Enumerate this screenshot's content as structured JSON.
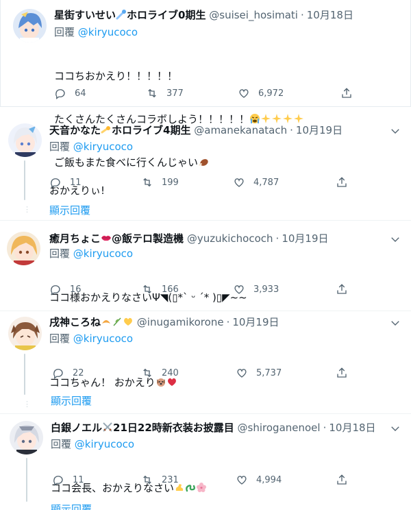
{
  "reply_prefix": "回覆",
  "show_replies_label": "顯示回覆",
  "tweets": [
    {
      "name": "星街すいせい",
      "name_suffix": "ホロライブ0期生",
      "handle": "@suisei_hosimati",
      "separator": "·",
      "time": "10月18日",
      "reply_to": "@kiryucoco",
      "lines": [
        "ココちおかえり！！！！！",
        "たくさんたくさんコラボしよう！！！！！",
        "ご飯もまた食べに行くんじゃい"
      ],
      "replies": "64",
      "retweets": "377",
      "likes": "6,972"
    },
    {
      "name": "天音かなた",
      "name_suffix": "ホロライブ4期生",
      "handle": "@amanekanatach",
      "separator": "·",
      "time": "10月19日",
      "reply_to": "@kiryucoco",
      "lines": [
        "おかえりぃ!"
      ],
      "replies": "11",
      "retweets": "199",
      "likes": "4,787"
    },
    {
      "name": "癒月ちょこ",
      "name_suffix": "@飯テロ製造機",
      "handle": "@yuzukichococh",
      "separator": "·",
      "time": "10月19日",
      "reply_to": "@kiryucoco",
      "lines": [
        "ココ様おかえりなさいΨ◥(▯*ˋ ᵕ ˊ* )▯◤~~"
      ],
      "replies": "16",
      "retweets": "166",
      "likes": "3,933"
    },
    {
      "name": "戌神ころね",
      "name_suffix": "",
      "handle": "@inugamikorone",
      "separator": "·",
      "time": "10月19日",
      "reply_to": "@kiryucoco",
      "lines": [
        "ココちゃん！ おかえり"
      ],
      "replies": "22",
      "retweets": "240",
      "likes": "5,737"
    },
    {
      "name": "白銀ノエル",
      "name_suffix": "21日22時新衣装お披露目",
      "handle": "@shiroganenoel",
      "separator": "·",
      "time": "10月18日",
      "reply_to": "@kiryucoco",
      "lines": [
        "ココ会長、おかえりなさい"
      ],
      "replies": "11",
      "retweets": "231",
      "likes": "4,994"
    }
  ],
  "icons": {
    "reply": "reply-icon",
    "retweet": "retweet-icon",
    "like": "heart-icon",
    "share": "share-icon",
    "more": "more-icon"
  },
  "colors": {
    "link": "#1d9bf0",
    "secondary_text": "#536471",
    "thread_line": "#cfd9de"
  }
}
